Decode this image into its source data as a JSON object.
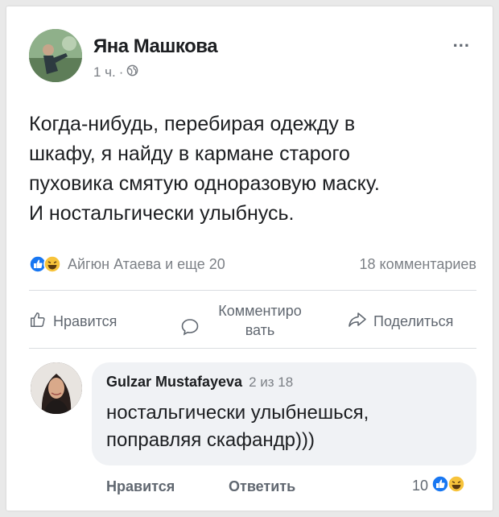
{
  "post": {
    "author": "Яна Машкова",
    "time": "1 ч.",
    "separator": "·",
    "more": "...",
    "text_lines": [
      "Когда-нибудь, перебирая одежду в",
      "шкафу, я найду в кармане старого",
      "пуховика смятую одноразовую маску.",
      "И ностальгически улыбнусь."
    ]
  },
  "reactions": {
    "summary": "Айгюн Атаева и еще 20",
    "comments": "18 комментариев",
    "icons": [
      "like-icon",
      "laugh-icon"
    ]
  },
  "actions": {
    "like": "Нравится",
    "comment_line1": "Комментиро",
    "comment_line2": "вать",
    "share": "Поделиться"
  },
  "comment": {
    "author": "Gulzar Mustafayeva",
    "position": "2 из 18",
    "text_lines": [
      "ностальгически улыбнешься,",
      "поправляя скафандр)))"
    ],
    "like": "Нравится",
    "reply": "Ответить",
    "reaction_count": "10"
  },
  "colors": {
    "like_blue": "#1877f2",
    "laugh_yellow": "#f7c33b",
    "text": "#1c1e21",
    "secondary": "#7c8086",
    "bubble": "#f0f2f5"
  }
}
